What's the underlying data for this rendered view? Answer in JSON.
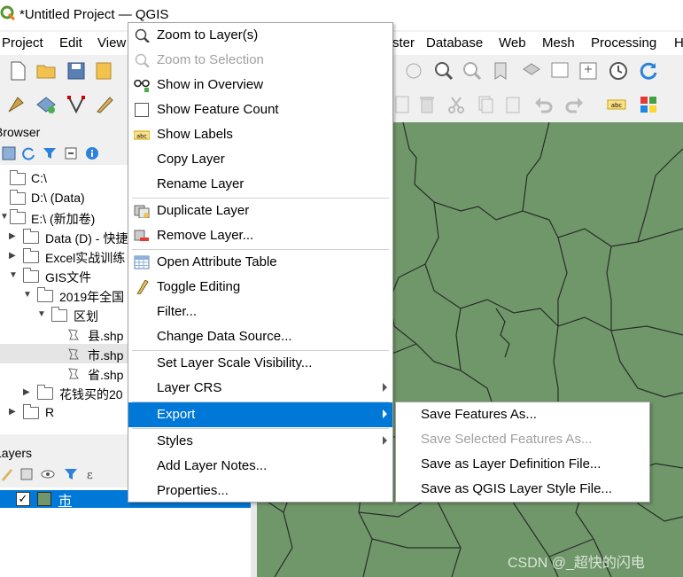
{
  "window": {
    "title": "*Untitled Project — QGIS"
  },
  "menubar": {
    "items": [
      "Project",
      "Edit",
      "View",
      "ster",
      "Database",
      "Web",
      "Mesh",
      "Processing",
      "H"
    ]
  },
  "browser": {
    "title": "Browser",
    "tree": [
      {
        "label": "C:\\"
      },
      {
        "label": "D:\\ (Data)"
      },
      {
        "label": "E:\\ (新加卷)"
      },
      {
        "label": "Data (D) - 快捷"
      },
      {
        "label": "Excel实战训练"
      },
      {
        "label": "GIS文件"
      },
      {
        "label": "2019年全国"
      },
      {
        "label": "区划"
      },
      {
        "label": "县.shp"
      },
      {
        "label": "市.shp"
      },
      {
        "label": "省.shp"
      },
      {
        "label": "花钱买的20"
      },
      {
        "label": "R"
      }
    ]
  },
  "layers": {
    "title": "Layers",
    "items": [
      {
        "name": "市",
        "checked": true
      }
    ]
  },
  "context_menu": {
    "items": [
      {
        "label": "Zoom to Layer(s)",
        "icon": "zoom-layer-icon"
      },
      {
        "label": "Zoom to Selection",
        "icon": "zoom-selection-icon",
        "disabled": true
      },
      {
        "label": "Show in Overview",
        "icon": "overview-icon"
      },
      {
        "label": "Show Feature Count",
        "icon": "checkbox-icon"
      },
      {
        "label": "Show Labels",
        "icon": "labels-icon"
      },
      {
        "label": "Copy Layer"
      },
      {
        "label": "Rename Layer"
      },
      {
        "label": "Duplicate Layer",
        "icon": "duplicate-icon"
      },
      {
        "label": "Remove Layer...",
        "icon": "remove-icon"
      },
      {
        "label": "Open Attribute Table",
        "icon": "table-icon"
      },
      {
        "label": "Toggle Editing",
        "icon": "pencil-icon"
      },
      {
        "label": "Filter..."
      },
      {
        "label": "Change Data Source..."
      },
      {
        "label": "Set Layer Scale Visibility..."
      },
      {
        "label": "Layer CRS",
        "submenu": true
      },
      {
        "label": "Export",
        "submenu": true,
        "highlighted": true
      },
      {
        "label": "Styles",
        "submenu": true
      },
      {
        "label": "Add Layer Notes..."
      },
      {
        "label": "Properties..."
      }
    ]
  },
  "export_submenu": {
    "items": [
      {
        "label": "Save Features As..."
      },
      {
        "label": "Save Selected Features As...",
        "disabled": true
      },
      {
        "label": "Save as Layer Definition File..."
      },
      {
        "label": "Save as QGIS Layer Style File..."
      }
    ]
  },
  "watermark": "CSDN @_超快的闪电",
  "colors": {
    "map_fill": "#6f9769",
    "highlight": "#0078d7",
    "boundary": "#2b2b2b"
  }
}
